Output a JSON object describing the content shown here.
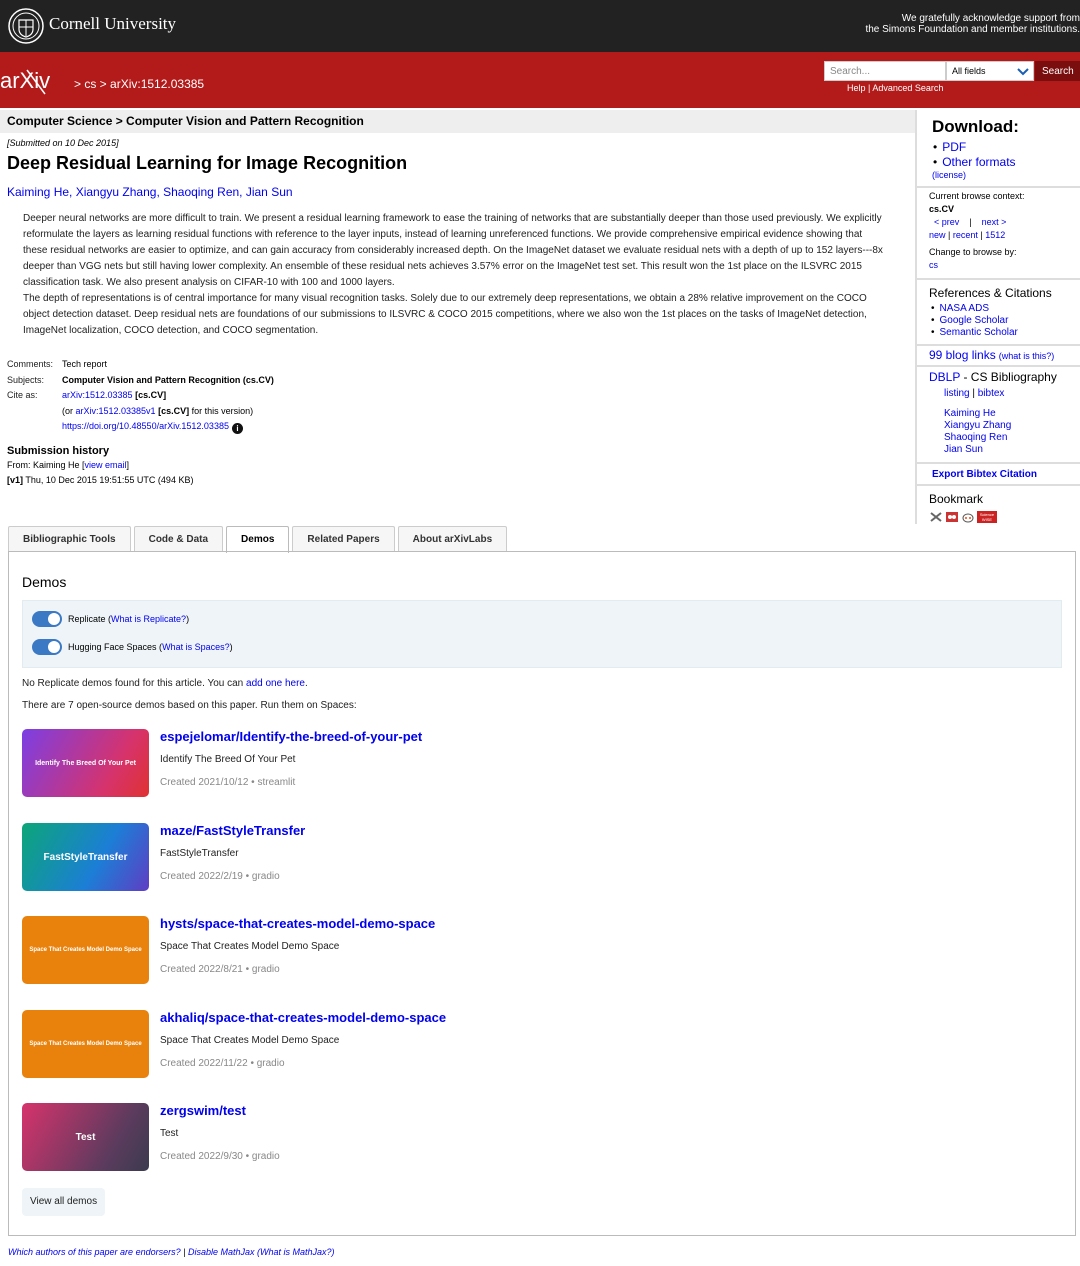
{
  "cornell": {
    "name": "Cornell University",
    "ack_line1": "We gratefully acknowledge support from",
    "ack_line2": "the Simons Foundation and member institutions."
  },
  "header": {
    "logo_text": "arXiv",
    "crumb": "> cs > arXiv:1512.03385",
    "search_placeholder": "Search...",
    "search_field": "All fields",
    "search_button": "Search",
    "help": "Help",
    "advanced": "Advanced Search",
    "bar_sep": "|"
  },
  "subject_heading": "Computer Science > Computer Vision and Pattern Recognition",
  "paper": {
    "submitted": "[Submitted on 10 Dec 2015]",
    "title": "Deep Residual Learning for Image Recognition",
    "authors": [
      "Kaiming He",
      "Xiangyu Zhang",
      "Shaoqing Ren",
      "Jian Sun"
    ],
    "author_sep": ", ",
    "abstract_p1": "Deeper neural networks are more difficult to train. We present a residual learning framework to ease the training of networks that are substantially deeper than those used previously. We explicitly reformulate the layers as learning residual functions with reference to the layer inputs, instead of learning unreferenced functions. We provide comprehensive empirical evidence showing that these residual networks are easier to optimize, and can gain accuracy from considerably increased depth. On the ImageNet dataset we evaluate residual nets with a depth of up to 152 layers---8x deeper than VGG nets but still having lower complexity. An ensemble of these residual nets achieves 3.57% error on the ImageNet test set. This result won the 1st place on the ILSVRC 2015 classification task. We also present analysis on CIFAR-10 with 100 and 1000 layers.",
    "abstract_p2": "The depth of representations is of central importance for many visual recognition tasks. Solely due to our extremely deep representations, we obtain a 28% relative improvement on the COCO object detection dataset. Deep residual nets are foundations of our submissions to ILSVRC & COCO 2015 competitions, where we also won the 1st places on the tasks of ImageNet detection, ImageNet localization, COCO detection, and COCO segmentation."
  },
  "meta": {
    "comments_label": "Comments:",
    "comments": "Tech report",
    "subjects_label": "Subjects:",
    "subjects": "Computer Vision and Pattern Recognition (cs.CV)",
    "cite_label": "Cite as:",
    "cite_id": "arXiv:1512.03385",
    "cite_tag": "[cs.CV]",
    "version_pre": "(or ",
    "version_id": "arXiv:1512.03385v1",
    "version_tag": "[cs.CV]",
    "version_post": " for this version)",
    "doi": "https://doi.org/10.48550/arXiv.1512.03385",
    "doi_icon": "i"
  },
  "history": {
    "title": "Submission history",
    "from_pre": "From: Kaiming He [",
    "view_email": "view email",
    "from_post": "]",
    "v1_label": "[v1]",
    "v1_text": " Thu, 10 Dec 2015 19:51:55 UTC (494 KB)"
  },
  "sidebar": {
    "download_title": "Download:",
    "pdf": "PDF",
    "other_formats": "Other formats",
    "license": "(license)",
    "context_label": "Current browse context:",
    "context": "cs.CV",
    "prev": "< prev",
    "next": "next >",
    "new": "new",
    "recent": "recent",
    "period": "1512",
    "change_label": "Change to browse by:",
    "browse_cs": "cs",
    "refs_title": "References & Citations",
    "refs": [
      "NASA ADS",
      "Google Scholar",
      "Semantic Scholar"
    ],
    "blog_links": "99 blog links",
    "blog_what": "(what is this?)",
    "dblp": "DBLP",
    "dblp_rest": " - CS Bibliography",
    "listing": "listing",
    "bibtex": "bibtex",
    "dblp_authors": [
      "Kaiming He",
      "Xiangyu Zhang",
      "Shaoqing Ren",
      "Jian Sun"
    ],
    "export_bibtex": "Export Bibtex Citation",
    "bookmark": "Bookmark",
    "science_wise_1": "Science",
    "science_wise_2": "WISE"
  },
  "tabs": [
    {
      "label": "Bibliographic Tools",
      "active": false
    },
    {
      "label": "Code & Data",
      "active": false
    },
    {
      "label": "Demos",
      "active": true
    },
    {
      "label": "Related Papers",
      "active": false
    },
    {
      "label": "About arXivLabs",
      "active": false
    }
  ],
  "demos": {
    "title": "Demos",
    "toggle1_label": "Replicate (",
    "toggle1_link": "What is Replicate?",
    "toggle2_label": "Hugging Face Spaces (",
    "toggle2_link": "What is Spaces?",
    "paren_close": ")",
    "no_replicate": "No Replicate demos found for this article. You can ",
    "add_one": "add one here",
    "period": ".",
    "count_text": "There are 7 open-source demos based on this paper. Run them on Spaces:",
    "items": [
      {
        "title": "espejelomar/Identify-the-breed-of-your-pet",
        "desc": "Identify The Breed Of Your Pet",
        "meta": "Created 2021/10/12 • streamlit",
        "thumb": "Identify The Breed Of Your Pet"
      },
      {
        "title": "maze/FastStyleTransfer",
        "desc": "FastStyleTransfer",
        "meta": "Created 2022/2/19 • gradio",
        "thumb": "FastStyleTransfer"
      },
      {
        "title": "hysts/space-that-creates-model-demo-space",
        "desc": "Space That Creates Model Demo Space",
        "meta": "Created 2022/8/21 • gradio",
        "thumb": "Space That Creates Model Demo Space"
      },
      {
        "title": "akhaliq/space-that-creates-model-demo-space",
        "desc": "Space That Creates Model Demo Space",
        "meta": "Created 2022/11/22 • gradio",
        "thumb": "Space That Creates Model Demo Space"
      },
      {
        "title": "zergswim/test",
        "desc": "Test",
        "meta": "Created 2022/9/30 • gradio",
        "thumb": "Test"
      }
    ],
    "view_all": "View all demos"
  },
  "footer": {
    "endorsers": "Which authors of this paper are endorsers?",
    "sep": "|",
    "disable_mathjax": "Disable MathJax",
    "what_mathjax": "(What is MathJax?)"
  }
}
